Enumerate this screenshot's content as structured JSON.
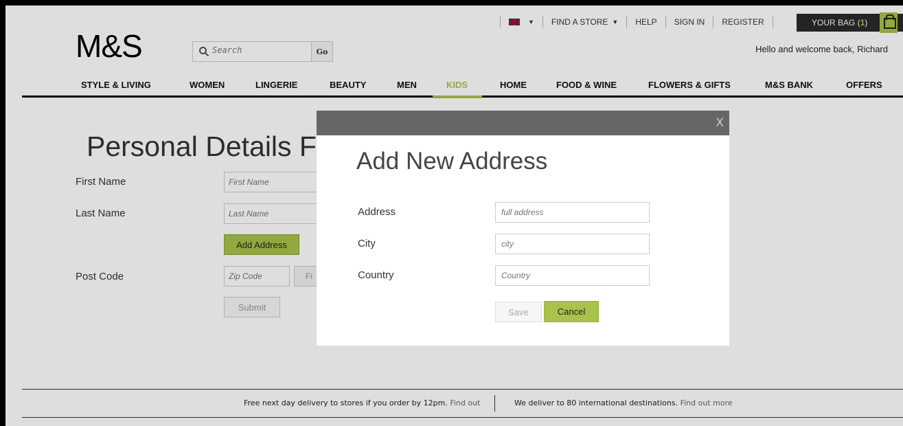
{
  "header": {
    "logo": "M&S",
    "search_placeholder": "Search",
    "go_label": "Go",
    "util_nav": {
      "find_a_store": "FIND A STORE",
      "help": "HELP",
      "sign_in": "SIGN IN",
      "register": "REGISTER"
    },
    "bag_label": "YOUR BAG (",
    "bag_count": "1",
    "bag_close": ")",
    "welcome": "Hello and welcome back, Richard"
  },
  "main_nav": {
    "items": [
      {
        "label": "STYLE & LIVING"
      },
      {
        "label": "WOMEN"
      },
      {
        "label": "LINGERIE"
      },
      {
        "label": "BEAUTY"
      },
      {
        "label": "MEN"
      },
      {
        "label": "KIDS"
      },
      {
        "label": "HOME"
      },
      {
        "label": "FOOD & WINE"
      },
      {
        "label": "FLOWERS & GIFTS"
      },
      {
        "label": "M&S BANK"
      },
      {
        "label": "OFFERS"
      }
    ],
    "active": "KIDS"
  },
  "form": {
    "title": "Personal Details Fo",
    "first_name_label": "First Name",
    "first_name_placeholder": "First Name",
    "last_name_label": "Last Name",
    "last_name_placeholder": "Last Name",
    "add_address_label": "Add Address",
    "post_code_label": "Post Code",
    "zip_placeholder": "Zip Code",
    "find_partial": "Fi",
    "submit_label": "Submit"
  },
  "modal": {
    "title": "Add New Address",
    "close": "X",
    "address_label": "Address",
    "address_placeholder": "full address",
    "city_label": "City",
    "city_placeholder": "city",
    "country_label": "Country",
    "country_placeholder": "Country",
    "save_label": "Save",
    "cancel_label": "Cancel"
  },
  "footer": {
    "delivery_msg": "Free next day delivery to stores if you order by 12pm.",
    "delivery_link": "Find out",
    "intl_msg": "We deliver to 80 international destinations.",
    "intl_link": "Find out more"
  },
  "colors": {
    "accent": "#a8c24a",
    "modal_header": "#666666"
  }
}
